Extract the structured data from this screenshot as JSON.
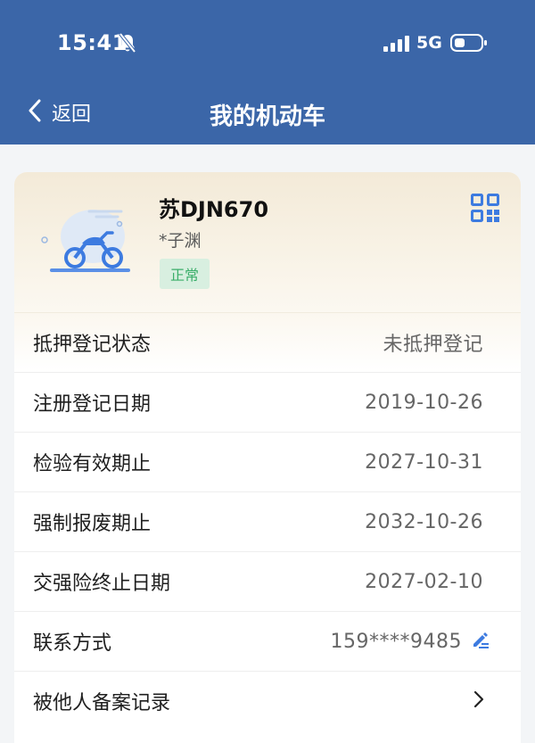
{
  "status_bar": {
    "time": "15:41",
    "network": "5G"
  },
  "nav": {
    "back_label": "返回",
    "title": "我的机动车"
  },
  "vehicle": {
    "plate": "苏DJN670",
    "owner": "*子渊",
    "status": "正常"
  },
  "rows": [
    {
      "label": "抵押登记状态",
      "value": "未抵押登记"
    },
    {
      "label": "注册登记日期",
      "value": "2019-10-26"
    },
    {
      "label": "检验有效期止",
      "value": "2027-10-31"
    },
    {
      "label": "强制报废期止",
      "value": "2032-10-26"
    },
    {
      "label": "交强险终止日期",
      "value": "2027-02-10"
    },
    {
      "label": "联系方式",
      "value": "159****9485"
    },
    {
      "label": "被他人备案记录",
      "value": ""
    }
  ],
  "icons": {
    "bell": "bell-slash-icon",
    "signal": "signal-bars-icon",
    "battery": "battery-icon",
    "back": "chevron-left-icon",
    "qr": "qr-code-icon",
    "edit": "edit-pen-icon",
    "arrow": "chevron-right-icon"
  },
  "colors": {
    "header": "#3b66a8",
    "accent": "#3d7be0",
    "status_ok_bg": "#d8efe0",
    "status_ok_text": "#3bae6a"
  }
}
